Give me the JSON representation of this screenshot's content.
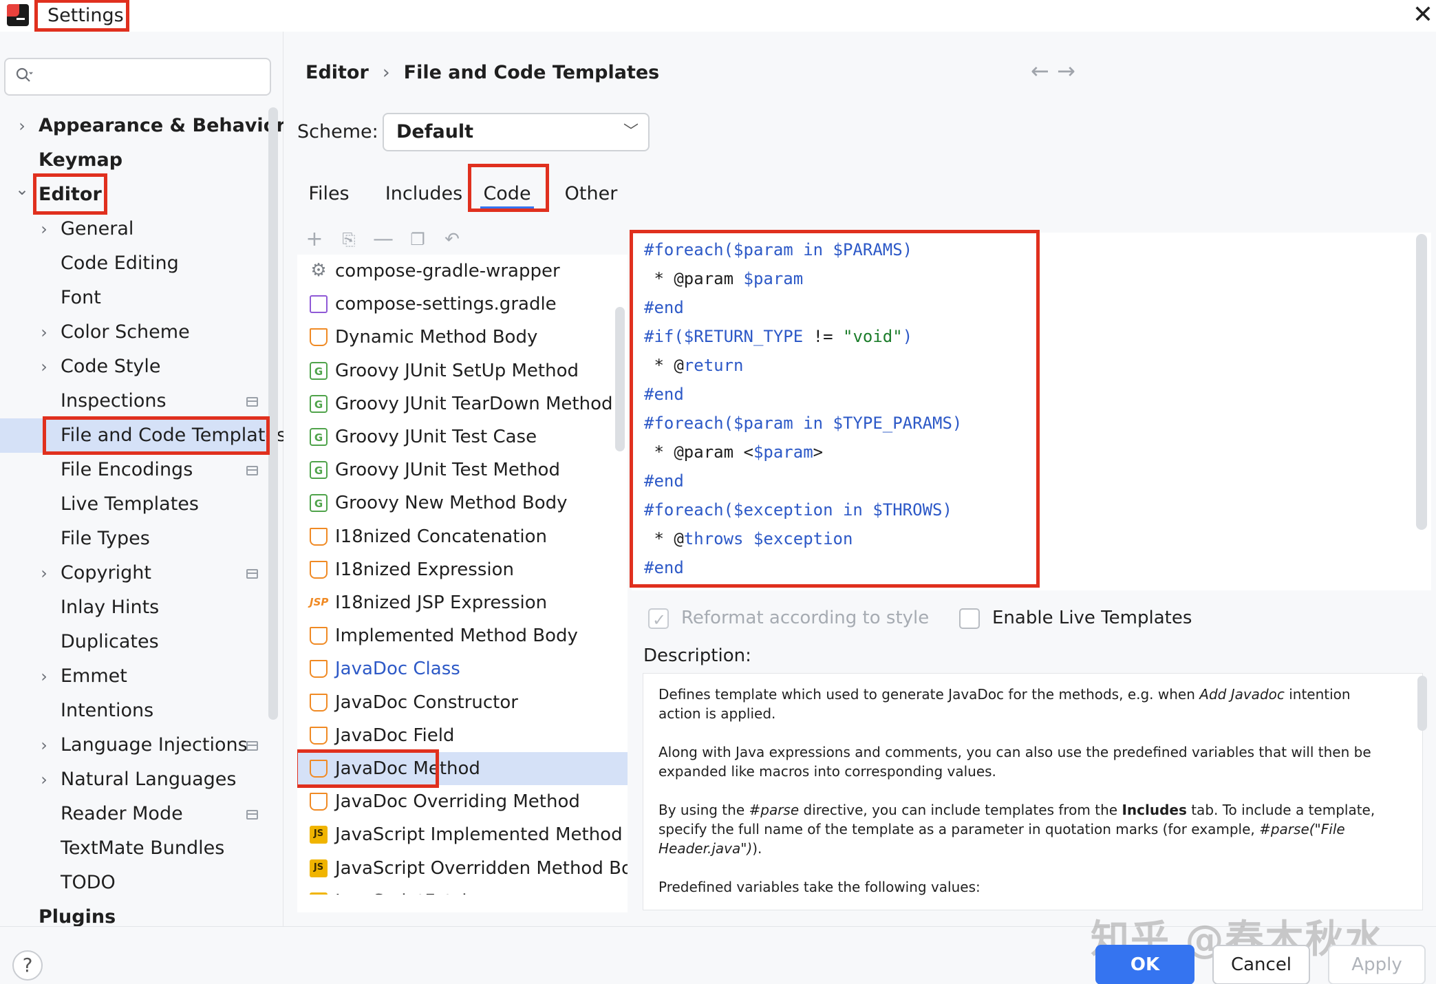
{
  "window": {
    "title": "Settings"
  },
  "search": {
    "placeholder": ""
  },
  "sidebar": {
    "items": [
      {
        "label": "Appearance & Behavior",
        "level": 0,
        "expandable": true,
        "expanded": false,
        "bold": true
      },
      {
        "label": "Keymap",
        "level": 0,
        "expandable": false,
        "bold": true
      },
      {
        "label": "Editor",
        "level": 0,
        "expandable": true,
        "expanded": true,
        "bold": true
      },
      {
        "label": "General",
        "level": 1,
        "expandable": true
      },
      {
        "label": "Code Editing",
        "level": 1
      },
      {
        "label": "Font",
        "level": 1
      },
      {
        "label": "Color Scheme",
        "level": 1,
        "expandable": true
      },
      {
        "label": "Code Style",
        "level": 1,
        "expandable": true
      },
      {
        "label": "Inspections",
        "level": 1,
        "project_scoped": true
      },
      {
        "label": "File and Code Templates",
        "level": 1,
        "selected": true
      },
      {
        "label": "File Encodings",
        "level": 1,
        "project_scoped": true
      },
      {
        "label": "Live Templates",
        "level": 1
      },
      {
        "label": "File Types",
        "level": 1
      },
      {
        "label": "Copyright",
        "level": 1,
        "expandable": true,
        "project_scoped": true
      },
      {
        "label": "Inlay Hints",
        "level": 1
      },
      {
        "label": "Duplicates",
        "level": 1
      },
      {
        "label": "Emmet",
        "level": 1,
        "expandable": true
      },
      {
        "label": "Intentions",
        "level": 1
      },
      {
        "label": "Language Injections",
        "level": 1,
        "expandable": true,
        "project_scoped": true
      },
      {
        "label": "Natural Languages",
        "level": 1,
        "expandable": true
      },
      {
        "label": "Reader Mode",
        "level": 1,
        "project_scoped": true
      },
      {
        "label": "TextMate Bundles",
        "level": 1
      },
      {
        "label": "TODO",
        "level": 1
      },
      {
        "label": "Plugins",
        "level": 0,
        "bold": true
      }
    ]
  },
  "breadcrumb": {
    "parent": "Editor",
    "separator": "›",
    "current": "File and Code Templates"
  },
  "scheme": {
    "label": "Scheme:",
    "value": "Default"
  },
  "tabs": [
    {
      "label": "Files"
    },
    {
      "label": "Includes"
    },
    {
      "label": "Code",
      "active": true
    },
    {
      "label": "Other"
    }
  ],
  "templates": [
    {
      "name": "compose-gradle-wrapper",
      "icon": "gear-icon"
    },
    {
      "name": "compose-settings.gradle",
      "icon": "gradle-icon"
    },
    {
      "name": "Dynamic Method Body",
      "icon": "java-icon"
    },
    {
      "name": "Groovy JUnit SetUp Method",
      "icon": "groovy-icon"
    },
    {
      "name": "Groovy JUnit TearDown Method",
      "icon": "groovy-icon"
    },
    {
      "name": "Groovy JUnit Test Case",
      "icon": "groovy-icon"
    },
    {
      "name": "Groovy JUnit Test Method",
      "icon": "groovy-icon"
    },
    {
      "name": "Groovy New Method Body",
      "icon": "groovy-icon"
    },
    {
      "name": "I18nized Concatenation",
      "icon": "java-icon"
    },
    {
      "name": "I18nized Expression",
      "icon": "java-icon"
    },
    {
      "name": "I18nized JSP Expression",
      "icon": "jsp-icon"
    },
    {
      "name": "Implemented Method Body",
      "icon": "java-icon"
    },
    {
      "name": "JavaDoc Class",
      "icon": "java-icon",
      "linked": true
    },
    {
      "name": "JavaDoc Constructor",
      "icon": "java-icon"
    },
    {
      "name": "JavaDoc Field",
      "icon": "java-icon"
    },
    {
      "name": "JavaDoc Method",
      "icon": "java-icon",
      "selected": true
    },
    {
      "name": "JavaDoc Overriding Method",
      "icon": "java-icon"
    },
    {
      "name": "JavaScript Implemented Method Bod",
      "icon": "js-icon"
    },
    {
      "name": "JavaScript Overridden Method Body",
      "icon": "js-icon"
    },
    {
      "name": "JavaScriptFetch",
      "icon": "js-icon"
    }
  ],
  "icons": {
    "groovy": "G",
    "jsp": "JSP",
    "js": "JS",
    "gear": "⚙"
  },
  "code_lines": [
    [
      {
        "t": "#foreach($param in $PARAMS)",
        "c": "kw"
      }
    ],
    [
      {
        "t": " * @param ",
        "c": "plain"
      },
      {
        "t": "$param",
        "c": "kw"
      }
    ],
    [
      {
        "t": "#end",
        "c": "kw"
      }
    ],
    [
      {
        "t": "#if($RETURN_TYPE ",
        "c": "kw"
      },
      {
        "t": "!= ",
        "c": "plain"
      },
      {
        "t": "\"void\"",
        "c": "str"
      },
      {
        "t": ")",
        "c": "kw"
      }
    ],
    [
      {
        "t": " * @",
        "c": "plain"
      },
      {
        "t": "return",
        "c": "kw"
      }
    ],
    [
      {
        "t": "#end",
        "c": "kw"
      }
    ],
    [
      {
        "t": "#foreach($param in $TYPE_PARAMS)",
        "c": "kw"
      }
    ],
    [
      {
        "t": " * @param <",
        "c": "plain"
      },
      {
        "t": "$param",
        "c": "kw"
      },
      {
        "t": ">",
        "c": "plain"
      }
    ],
    [
      {
        "t": "#end",
        "c": "kw"
      }
    ],
    [
      {
        "t": "#foreach($exception in $THROWS)",
        "c": "kw"
      }
    ],
    [
      {
        "t": " * @",
        "c": "plain"
      },
      {
        "t": "throws $exception",
        "c": "kw"
      }
    ],
    [
      {
        "t": "#end",
        "c": "kw"
      }
    ]
  ],
  "options": {
    "reformat": {
      "label": "Reformat according to style",
      "checked": true,
      "enabled": false
    },
    "live_templates": {
      "label": "Enable Live Templates",
      "checked": false
    }
  },
  "description": {
    "label": "Description:",
    "p1_a": "Defines template which used to generate JavaDoc for the methods, e.g. when ",
    "p1_b": "Add Javadoc",
    "p1_c": " intention action is applied.",
    "p2": "Along with Java expressions and comments, you can also use the predefined variables that will then be expanded like macros into corresponding values.",
    "p3_a": "By using the ",
    "p3_b": "#parse",
    "p3_c": " directive, you can include templates from the ",
    "p3_d": "Includes",
    "p3_e": " tab. To include a template, specify the full name of the template as a parameter in quotation marks (for example, ",
    "p3_f": "#parse(\"File Header.java\")",
    "p3_g": ").",
    "p4": "Predefined variables take the following values:"
  },
  "footer": {
    "help": "?",
    "ok": "OK",
    "cancel": "Cancel",
    "apply": "Apply",
    "watermark": "知乎 @春木秋水"
  },
  "colors": {
    "accent": "#3574f0",
    "highlight": "#e0301e",
    "selection": "#d5e1f7",
    "code_keyword": "#2d59c7",
    "code_string": "#1c7d2b"
  }
}
